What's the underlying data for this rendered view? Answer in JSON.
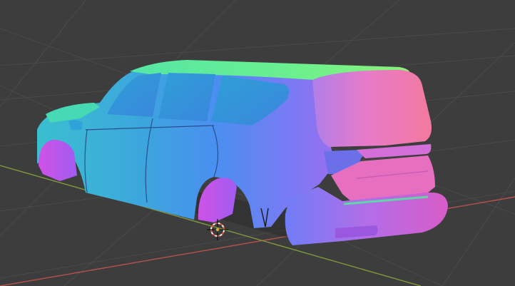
{
  "viewport": {
    "background": "#3d3d3d",
    "grid_color": "#4a4a4a",
    "x_axis_color": "#b5524f",
    "y_axis_color": "#7e9a3c"
  },
  "object": {
    "shading": "normal-map",
    "icon": "car-icon"
  },
  "origin_marker": {
    "icon": "3d-cursor-icon",
    "ring_color": "#ffffff",
    "accent_color": "#e25b3e"
  }
}
